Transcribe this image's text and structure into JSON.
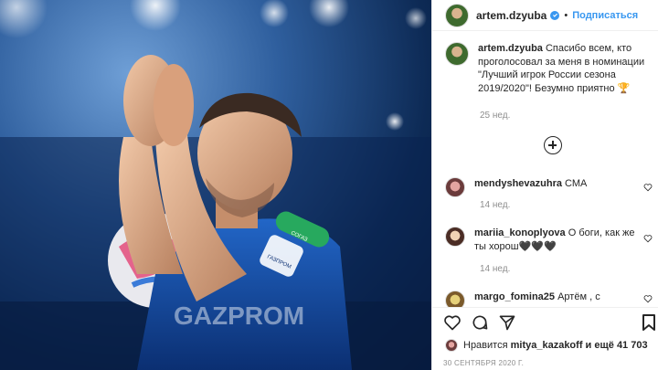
{
  "post": {
    "username": "artem.dzyuba",
    "follow_label": "Подписаться",
    "separator": "•"
  },
  "caption": {
    "username": "artem.dzyuba",
    "text": "Спасибо всем, кто проголосовал за меня в номинации \"Лучший игрок России сезона 2019/2020\"! Безумно приятно 🏆",
    "time": "25 нед."
  },
  "comments": [
    {
      "username": "mendyshevazuhra",
      "text": "СМА",
      "time": "14 нед."
    },
    {
      "username": "mariia_konoplyova",
      "text": "О боги, как же ты хорош🖤🖤🖤",
      "time": "14 нед."
    },
    {
      "username": "margo_fomina25",
      "text": "Артём , с"
    }
  ],
  "likes": {
    "prefix": "Нравится",
    "user": "mitya_kazakoff",
    "suffix": "и ещё 41 703"
  },
  "date": "30 СЕНТЯБРЯ 2020 Г.",
  "photo": {
    "jersey_text": "GAZPROM",
    "badge_text": "СОГАЗ",
    "sponsor_text": "ГАЗПРОМ"
  },
  "icons": [
    "verified-icon",
    "heart-icon",
    "comment-icon",
    "share-icon",
    "bookmark-icon",
    "add-comment-icon"
  ],
  "colors": {
    "accent": "#3897f0",
    "muted": "#8e8e8e",
    "text": "#262626"
  }
}
